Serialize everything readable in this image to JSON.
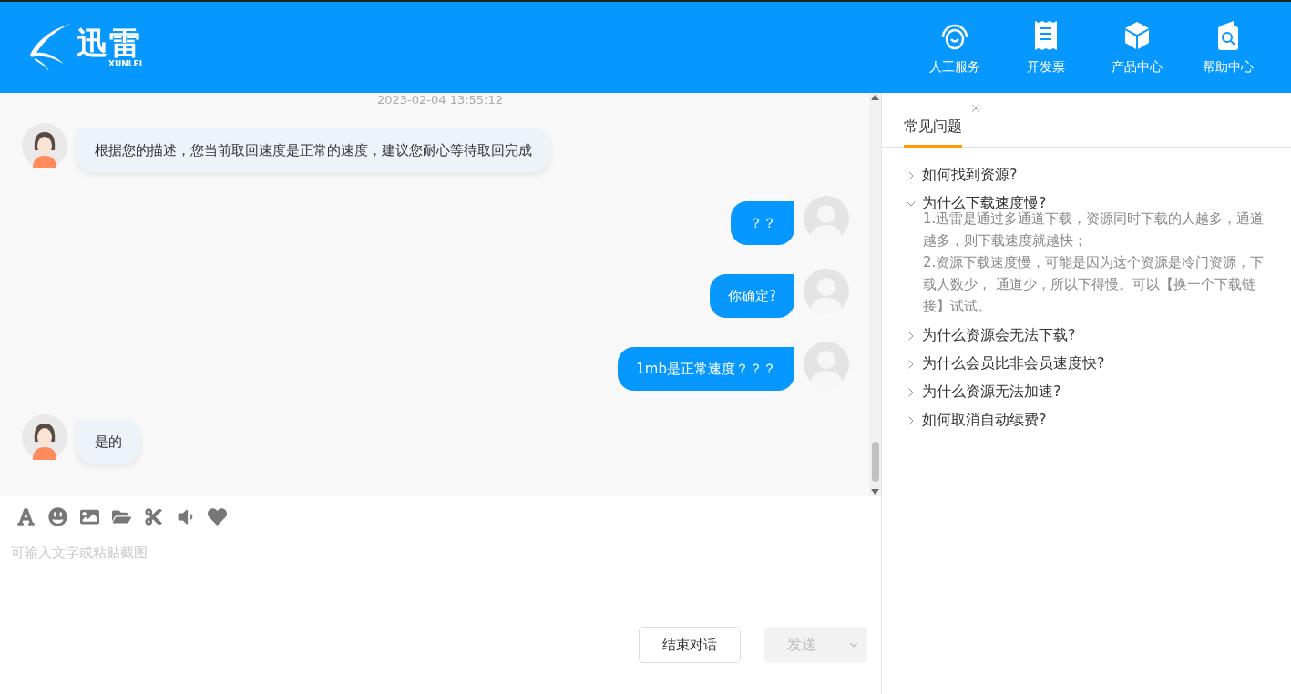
{
  "header": {
    "logo_text": "迅雷",
    "logo_subtext": "XUNLEI",
    "nav": [
      {
        "kind": "headset",
        "label": "人工服务"
      },
      {
        "kind": "receipt",
        "label": "开发票"
      },
      {
        "kind": "box",
        "label": "产品中心"
      },
      {
        "kind": "help",
        "label": "帮助中心"
      }
    ]
  },
  "chat": {
    "timestamp": "2023-02-04 13:55:12",
    "messages": [
      {
        "kind": "agent",
        "text": "根据您的描述，您当前取回速度是正常的速度，建议您耐心等待取回完成"
      },
      {
        "kind": "user",
        "text": "？？"
      },
      {
        "kind": "user",
        "text": "你确定?"
      },
      {
        "kind": "user",
        "text": "1mb是正常速度？？？"
      },
      {
        "kind": "agent",
        "text": "是的"
      }
    ]
  },
  "composer": {
    "placeholder": "可输入文字或粘贴截图",
    "end_button": "结束对话",
    "send_button": {
      "label": "发送",
      "disabled": true
    }
  },
  "faq": {
    "tab": {
      "label": "常见问题",
      "selected": true
    },
    "items": [
      {
        "question": "如何找到资源?",
        "expanded": false
      },
      {
        "question": "为什么下载速度慢?",
        "expanded": true,
        "answer": [
          "1.迅雷是通过多通道下载，资源同时下载的人越多，通道越多，则下载速度就越快；",
          "2.资源下载速度慢，可能是因为这个资源是冷门资源，下载人数少， 通道少，所以下得慢。可以【换一个下载链接】试试。"
        ]
      },
      {
        "question": "为什么资源会无法下载?",
        "expanded": false
      },
      {
        "question": "为什么会员比非会员速度快?",
        "expanded": false
      },
      {
        "question": "为什么资源无法加速?",
        "expanded": false
      },
      {
        "question": "如何取消自动续费?",
        "expanded": false
      }
    ]
  }
}
